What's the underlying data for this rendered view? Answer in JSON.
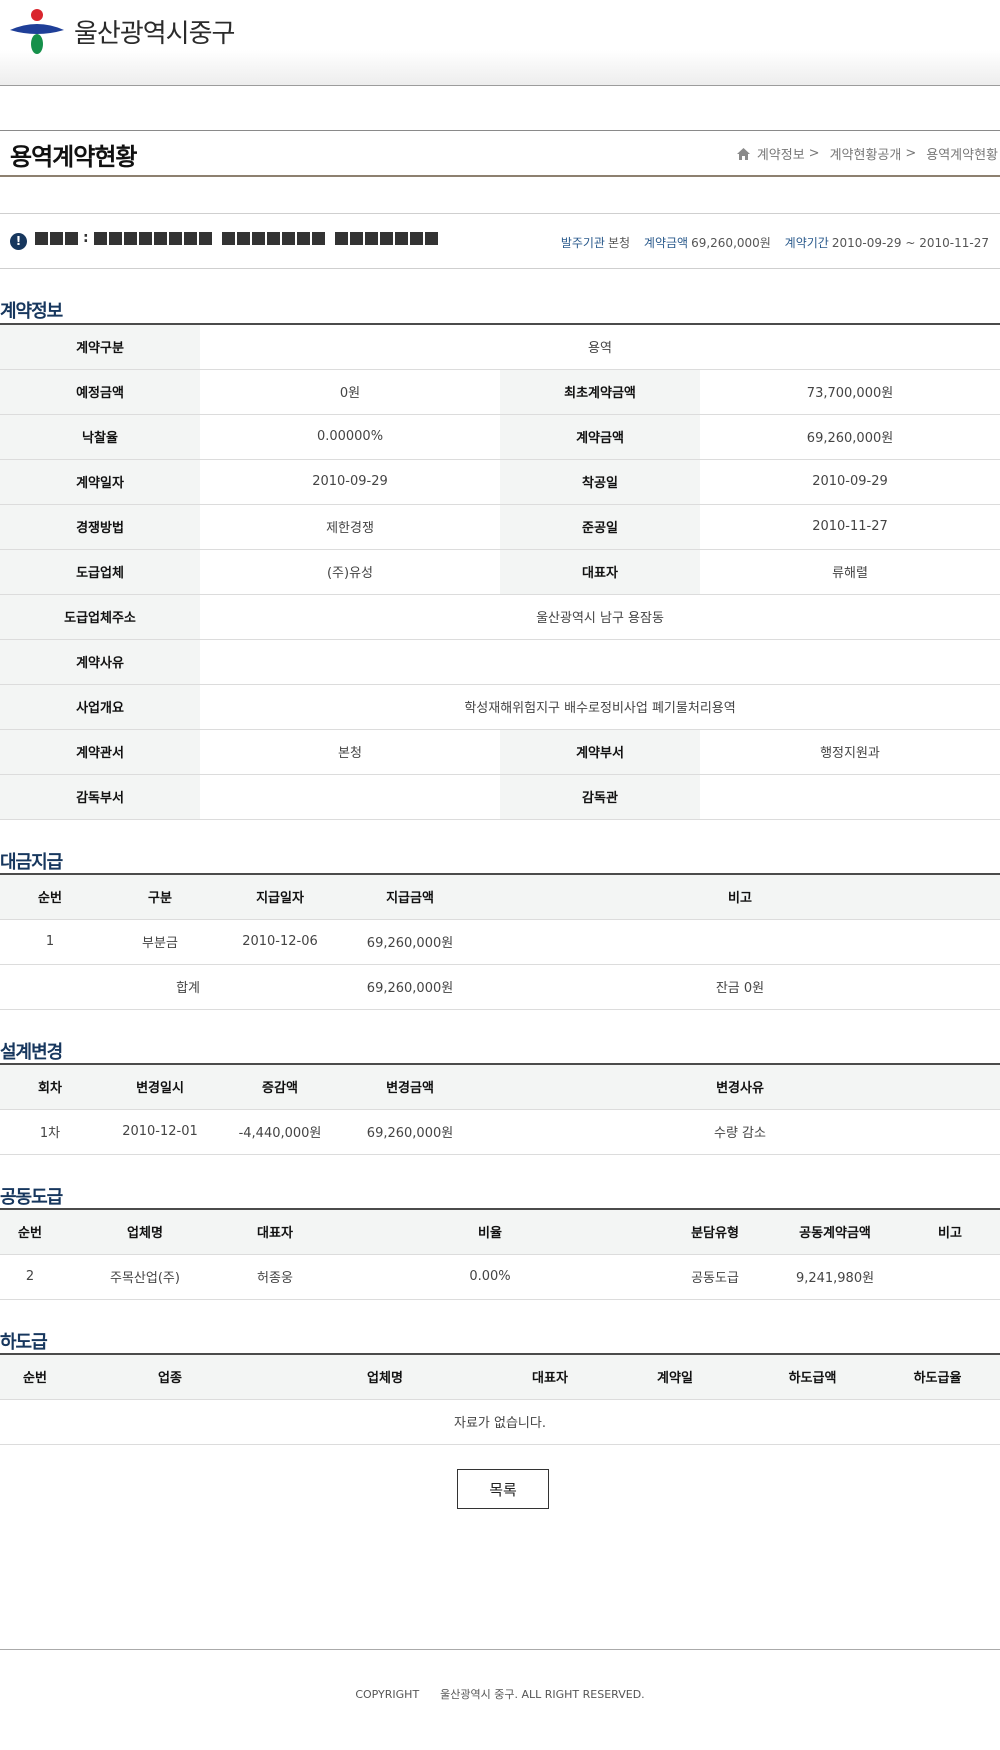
{
  "header": {
    "logo_text": "울산광역시중구"
  },
  "title_bar": {
    "title": "용역계약현황",
    "breadcrumb": [
      "계약정보",
      "계약현황공개",
      "용역계약현황"
    ],
    "sep": ">"
  },
  "summary": {
    "colon": ":",
    "agency_label": "발주기관",
    "agency_value": "본청",
    "amount_label": "계약금액",
    "amount_value": "69,260,000원",
    "period_label": "계약기간",
    "period_value": "2010-09-29 ~ 2010-11-27"
  },
  "contract_info": {
    "title": "계약정보",
    "rows": [
      {
        "l1": "계약구분",
        "v1": "용역"
      },
      {
        "l1": "예정금액",
        "v1": "0원",
        "l2": "최초계약금액",
        "v2": "73,700,000원"
      },
      {
        "l1": "낙찰율",
        "v1": "0.00000%",
        "l2": "계약금액",
        "v2": "69,260,000원"
      },
      {
        "l1": "계약일자",
        "v1": "2010-09-29",
        "l2": "착공일",
        "v2": "2010-09-29"
      },
      {
        "l1": "경쟁방법",
        "v1": "제한경쟁",
        "l2": "준공일",
        "v2": "2010-11-27"
      },
      {
        "l1": "도급업체",
        "v1": "(주)유성",
        "l2": "대표자",
        "v2": "류해렬"
      },
      {
        "l1": "도급업체주소",
        "v1": "울산광역시 남구 용잠동"
      },
      {
        "l1": "계약사유",
        "v1": ""
      },
      {
        "l1": "사업개요",
        "v1": "학성재해위험지구 배수로정비사업 폐기물처리용역"
      },
      {
        "l1": "계약관서",
        "v1": "본청",
        "l2": "계약부서",
        "v2": "행정지원과"
      },
      {
        "l1": "감독부서",
        "v1": "",
        "l2": "감독관",
        "v2": ""
      }
    ]
  },
  "payment": {
    "title": "대금지급",
    "headers": [
      "순번",
      "구분",
      "지급일자",
      "지급금액",
      "비고"
    ],
    "row": [
      "1",
      "부분금",
      "2010-12-06",
      "69,260,000원",
      ""
    ],
    "total": {
      "label": "합계",
      "amount": "69,260,000원",
      "note": "잔금 0원"
    }
  },
  "design_change": {
    "title": "설계변경",
    "headers": [
      "회차",
      "변경일시",
      "증감액",
      "변경금액",
      "변경사유"
    ],
    "row": [
      "1차",
      "2010-12-01",
      "-4,440,000원",
      "69,260,000원",
      "수량 감소"
    ]
  },
  "joint": {
    "title": "공동도급",
    "headers": [
      "순번",
      "업체명",
      "대표자",
      "비율",
      "분담유형",
      "공동계약금액",
      "비고"
    ],
    "row": [
      "2",
      "주목산업(주)",
      "허종웅",
      "0.00%",
      "공동도급",
      "9,241,980원",
      ""
    ]
  },
  "subcontract": {
    "title": "하도급",
    "headers": [
      "순번",
      "업종",
      "업체명",
      "대표자",
      "계약일",
      "하도급액",
      "하도급율"
    ],
    "empty": "자료가 없습니다."
  },
  "list_button": "목록",
  "footer": {
    "copyright": "COPYRIGHT      울산광역시 중구. ALL RIGHT RESERVED."
  }
}
